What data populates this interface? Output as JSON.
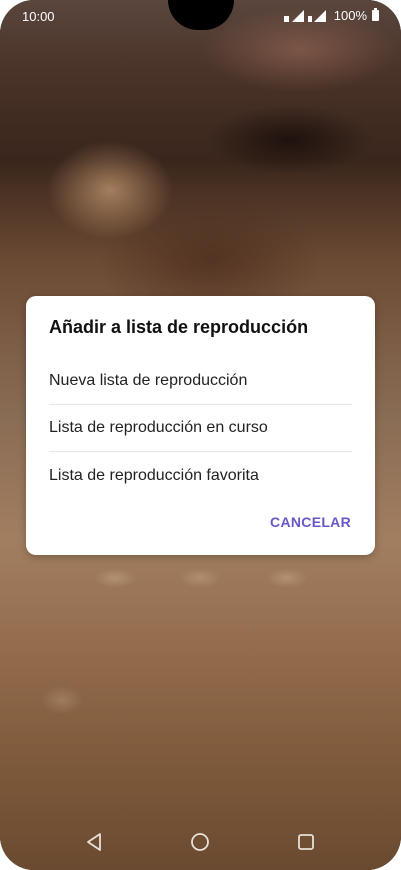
{
  "status_bar": {
    "time": "10:00",
    "battery": "100%"
  },
  "dialog": {
    "title": "Añadir a lista de reproducción",
    "options": [
      "Nueva lista de reproducción",
      "Lista de reproducción en curso",
      "Lista de reproducción favorita"
    ],
    "cancel_label": "CANCELAR"
  },
  "navigation": {
    "icons": [
      "back-icon",
      "home-icon",
      "recents-icon"
    ]
  },
  "colors": {
    "accent": "#6a57c7",
    "dialog_bg": "#ffffff"
  }
}
